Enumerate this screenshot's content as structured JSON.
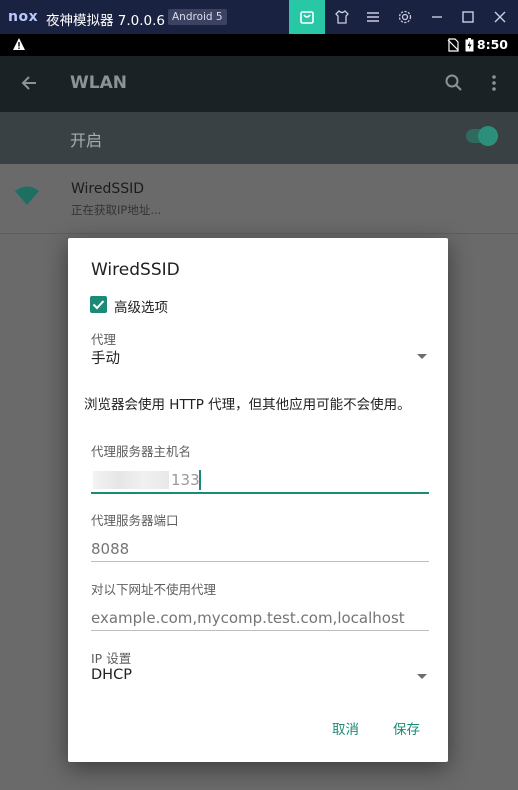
{
  "emulator": {
    "logo": "nox",
    "title": "夜神模拟器 7.0.0.6",
    "android_badge": "Android 5",
    "buttons": [
      "app-store-icon",
      "shirt-icon",
      "menu-icon",
      "gear-icon",
      "minimize-icon",
      "maximize-icon",
      "close-icon"
    ]
  },
  "statusbar": {
    "time": "8:50"
  },
  "appbar": {
    "title": "WLAN"
  },
  "wlan_switch": {
    "label": "开启",
    "on": true
  },
  "network": {
    "name": "WiredSSID",
    "status": "正在获取IP地址..."
  },
  "dialog": {
    "title": "WiredSSID",
    "advanced_label": "高级选项",
    "advanced_checked": true,
    "proxy": {
      "label": "代理",
      "value": "手动"
    },
    "note": "浏览器会使用 HTTP 代理，但其他应用可能不会使用。",
    "proxy_host": {
      "label": "代理服务器主机名",
      "value_visible": "133"
    },
    "proxy_port": {
      "label": "代理服务器端口",
      "placeholder": "8088"
    },
    "bypass": {
      "label": "对以下网址不使用代理",
      "placeholder": "example.com,mycomp.test.com,localhost"
    },
    "ip_settings": {
      "label": "IP 设置",
      "value": "DHCP"
    },
    "cancel_label": "取消",
    "save_label": "保存"
  },
  "colors": {
    "accent": "#1d8a78",
    "titlebar": "#1a2241",
    "active_tab": "#28c7a6"
  }
}
